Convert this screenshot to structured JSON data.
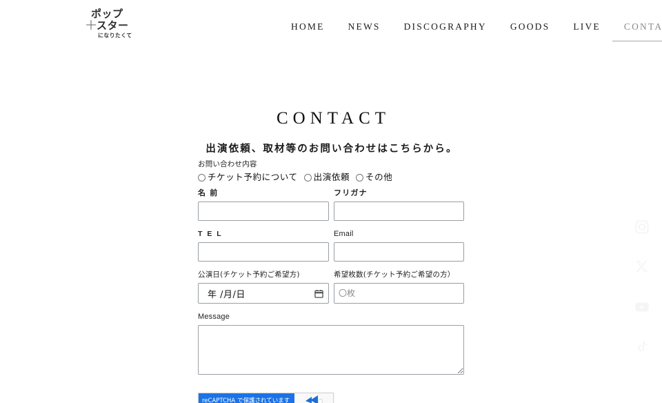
{
  "site": {
    "logo": {
      "line1": "ポップ",
      "line2": "スター",
      "line3": "になりたくて",
      "alt": "ポップスターになりたくて"
    }
  },
  "nav": {
    "items": [
      {
        "label": "HOME",
        "active": false
      },
      {
        "label": "NEWS",
        "active": false
      },
      {
        "label": "DISCOGRAPHY",
        "active": false
      },
      {
        "label": "GOODS",
        "active": false
      },
      {
        "label": "LIVE",
        "active": false
      },
      {
        "label": "CONTACT",
        "active": true
      }
    ]
  },
  "page": {
    "title": "CONTACT",
    "subtitle": "出演依頼、取材等のお問い合わせはこちらから。"
  },
  "form": {
    "inquiry": {
      "label": "お問い合わせ内容",
      "options": [
        {
          "label": "チケット予約について",
          "checked": false
        },
        {
          "label": "出演依頼",
          "checked": false
        },
        {
          "label": "その他",
          "checked": false
        }
      ]
    },
    "name": {
      "label": "名 前",
      "value": "",
      "placeholder": ""
    },
    "furigana": {
      "label": "フリガナ",
      "value": "",
      "placeholder": ""
    },
    "tel": {
      "label": "T E L",
      "value": "",
      "placeholder": ""
    },
    "email": {
      "label": "Email",
      "value": "",
      "placeholder": ""
    },
    "show_date": {
      "label": "公演日(チケット予約ご希望方)",
      "value": "年 /月/日"
    },
    "tickets": {
      "label": "希望枚数(チケット予約ご希望の方）",
      "value": "",
      "placeholder": "〇枚"
    },
    "message": {
      "label": "Message",
      "value": "",
      "placeholder": ""
    }
  },
  "recaptcha": {
    "text": "reCAPTCHA で保護されています",
    "brand_color": "#1a73e8"
  },
  "social": {
    "items": [
      {
        "name": "instagram",
        "label": "Instagram"
      },
      {
        "name": "x-twitter",
        "label": "X"
      },
      {
        "name": "youtube",
        "label": "YouTube"
      },
      {
        "name": "tiktok",
        "label": "TikTok"
      }
    ],
    "color": "#f5f5f5"
  },
  "colors": {
    "background": "#ffffff",
    "text": "#1a1a1a",
    "muted": "#8a8a8a",
    "input_border": "#999ea3"
  }
}
